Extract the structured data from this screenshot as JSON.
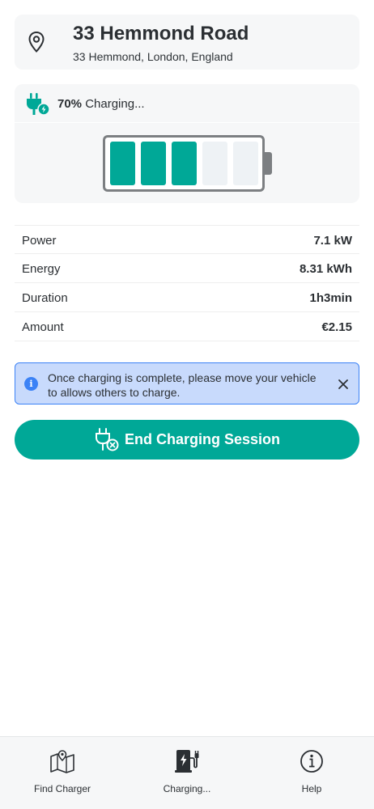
{
  "location": {
    "title": "33 Hemmond Road",
    "address": "33 Hemmond, London, England",
    "icon": "map-pin-icon"
  },
  "charging": {
    "percent_label": "70%",
    "status_label": "Charging...",
    "battery_level": 0.7,
    "battery_cells_filled": 3,
    "battery_cells_total": 5,
    "icon": "plug-charging-icon"
  },
  "stats": [
    {
      "label": "Power",
      "value": "7.1 kW"
    },
    {
      "label": "Energy",
      "value": "8.31 kWh"
    },
    {
      "label": "Duration",
      "value": "1h3min"
    },
    {
      "label": "Amount",
      "value": "€2.15"
    }
  ],
  "info_banner": {
    "text": "Once charging is complete, please move your vehicle to allows others to charge.",
    "icon": "info-icon",
    "close_icon": "close-icon"
  },
  "end_button": {
    "label": "End Charging Session",
    "icon": "unplug-icon"
  },
  "nav": {
    "items": [
      {
        "label": "Find Charger",
        "icon": "map-icon"
      },
      {
        "label": "Charging...",
        "icon": "charging-station-icon",
        "active": true
      },
      {
        "label": "Help",
        "icon": "info-circle-icon"
      }
    ]
  },
  "colors": {
    "accent": "#00a897",
    "card_bg": "#f6f7f8",
    "banner_bg": "#c8dafc",
    "banner_border": "#3b82f6"
  }
}
